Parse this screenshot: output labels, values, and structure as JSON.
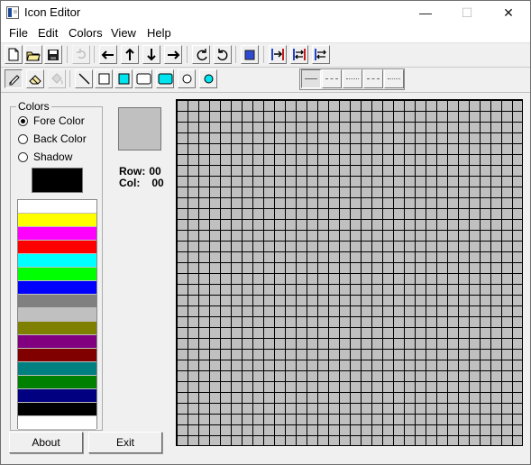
{
  "window": {
    "title": "Icon Editor",
    "controls": {
      "minimize": "—",
      "maximize": "☐",
      "close": "✕"
    }
  },
  "menu": [
    "File",
    "Edit",
    "Colors",
    "View",
    "Help"
  ],
  "toolbar_top": [
    {
      "name": "new-file-icon"
    },
    {
      "name": "open-folder-icon"
    },
    {
      "name": "save-icon"
    },
    {
      "name": "undo-icon",
      "disabled": true
    },
    {
      "name": "arrow-left-icon"
    },
    {
      "name": "arrow-up-icon"
    },
    {
      "name": "arrow-down-icon"
    },
    {
      "name": "arrow-right-icon"
    },
    {
      "name": "rotate-clockwise-icon"
    },
    {
      "name": "rotate-counterclockwise-icon"
    },
    {
      "name": "stop-color-icon"
    },
    {
      "name": "flip-horizontal-icon"
    },
    {
      "name": "mirror-icon"
    },
    {
      "name": "swap-icon"
    }
  ],
  "toolbar_draw": [
    {
      "name": "pencil-icon",
      "active": true
    },
    {
      "name": "eraser-icon"
    },
    {
      "name": "fill-icon",
      "disabled": true
    },
    {
      "name": "line-icon"
    },
    {
      "name": "rectangle-icon"
    },
    {
      "name": "filled-rectangle-icon"
    },
    {
      "name": "rounded-rectangle-icon"
    },
    {
      "name": "filled-rounded-rectangle-icon"
    },
    {
      "name": "ellipse-icon"
    },
    {
      "name": "filled-ellipse-icon"
    }
  ],
  "line_styles": [
    "solid",
    "dashed",
    "dotted",
    "dash-dot",
    "dash-dot-dot"
  ],
  "colors_panel": {
    "title": "Colors",
    "options": [
      {
        "label": "Fore Color",
        "checked": true
      },
      {
        "label": "Back Color",
        "checked": false
      },
      {
        "label": "Shadow",
        "checked": false
      }
    ],
    "current_color": "#000000",
    "palette": [
      "#ffffff",
      "#ffff00",
      "#ff00ff",
      "#ff0000",
      "#00ffff",
      "#00ff00",
      "#0000ff",
      "#808080",
      "#c0c0c0",
      "#808000",
      "#800080",
      "#800000",
      "#008080",
      "#008000",
      "#000080",
      "#000000",
      "#ffffff"
    ]
  },
  "preview": {
    "fill": "#c0c0c0"
  },
  "coords": {
    "row_label": "Row:",
    "row_value": "00",
    "col_label": "Col:",
    "col_value": "00"
  },
  "editor_grid": {
    "rows": 32,
    "cols": 32,
    "fill": "#c0c0c0"
  },
  "buttons": {
    "about": "About",
    "exit": "Exit"
  }
}
